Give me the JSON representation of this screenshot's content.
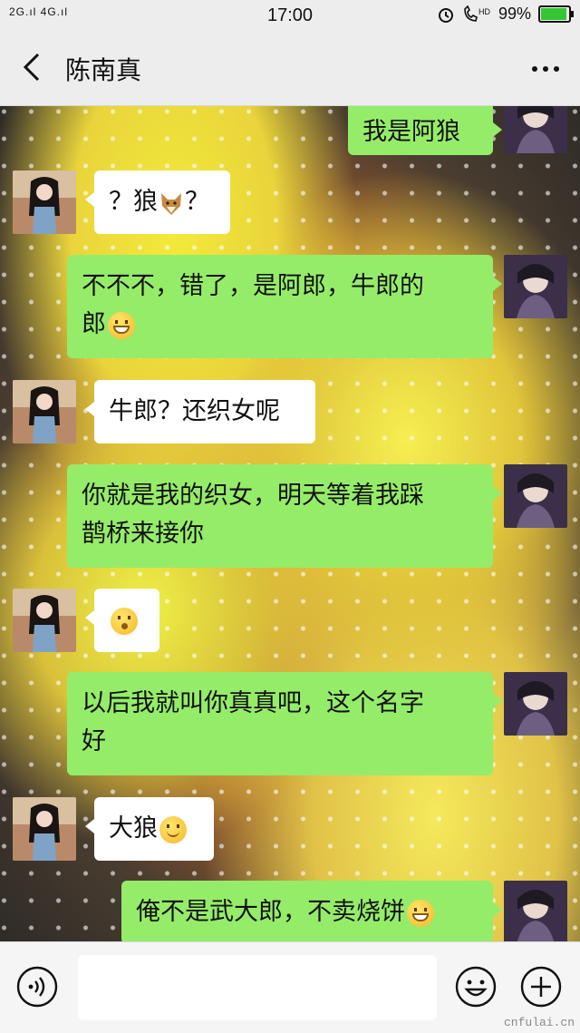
{
  "status_bar": {
    "signal_left": "2G.ıl 4G.ıl",
    "time": "17:00",
    "battery_percent": "99%",
    "battery_level": 0.99
  },
  "header": {
    "back_icon": "chevron-left-icon",
    "title": "陈南真",
    "more_icon": "more-dots-icon"
  },
  "messages": [
    {
      "side": "right",
      "text": "我是阿狼"
    },
    {
      "side": "left",
      "text_before": "？狼",
      "emoji": "wolf",
      "text_after": "？"
    },
    {
      "side": "right",
      "text_line1": "不不不，错了，是阿郎，牛郎的",
      "text_line2": "郎",
      "emoji": "grin"
    },
    {
      "side": "left",
      "text": "牛郎？还织女呢"
    },
    {
      "side": "right",
      "text_line1": "你就是我的织女，明天等着我踩",
      "text_line2": "鹊桥来接你"
    },
    {
      "side": "left",
      "emoji": "surprise"
    },
    {
      "side": "right",
      "text_line1": "以后我就叫你真真吧，这个名字",
      "text_line2": "好"
    },
    {
      "side": "left",
      "text": "大狼",
      "emoji": "smile"
    },
    {
      "side": "right",
      "text": "俺不是武大郎，不卖烧饼",
      "emoji": "grin"
    }
  ],
  "input_bar": {
    "voice_icon": "voice-icon",
    "placeholder": "",
    "emoji_icon": "emoji-icon",
    "plus_icon": "plus-icon"
  },
  "watermark": "cnfulai.cn",
  "colors": {
    "bubble_green": "#95ec69",
    "bubble_white": "#ffffff",
    "header_bg": "#ededed"
  }
}
